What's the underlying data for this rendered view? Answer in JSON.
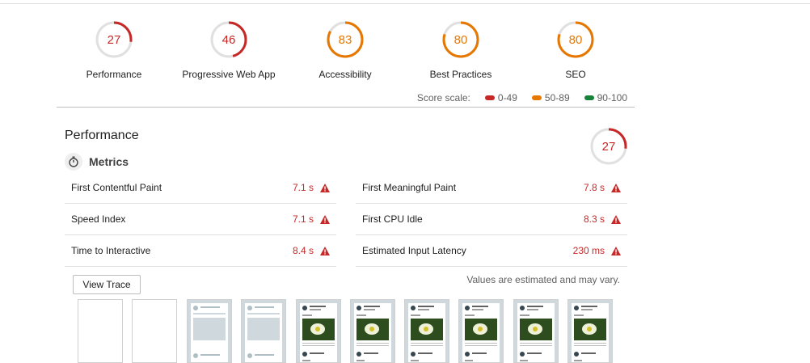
{
  "gauges": [
    {
      "score": "27",
      "label": "Performance",
      "value": 27,
      "color": "#c62828"
    },
    {
      "score": "46",
      "label": "Progressive Web App",
      "value": 46,
      "color": "#c62828"
    },
    {
      "score": "83",
      "label": "Accessibility",
      "value": 83,
      "color": "#e67700"
    },
    {
      "score": "80",
      "label": "Best Practices",
      "value": 80,
      "color": "#e67700"
    },
    {
      "score": "80",
      "label": "SEO",
      "value": 80,
      "color": "#e67700"
    }
  ],
  "legend": {
    "title": "Score scale:",
    "items": [
      {
        "label": "0-49",
        "color": "#c62828"
      },
      {
        "label": "50-89",
        "color": "#e67700"
      },
      {
        "label": "90-100",
        "color": "#178239"
      }
    ]
  },
  "performance": {
    "title": "Performance",
    "score": "27",
    "score_value": 27,
    "metrics_title": "Metrics",
    "left_metrics": [
      {
        "name": "First Contentful Paint",
        "value": "7.1 s"
      },
      {
        "name": "Speed Index",
        "value": "7.1 s"
      },
      {
        "name": "Time to Interactive",
        "value": "8.4 s"
      }
    ],
    "right_metrics": [
      {
        "name": "First Meaningful Paint",
        "value": "7.8 s"
      },
      {
        "name": "First CPU Idle",
        "value": "8.3 s"
      },
      {
        "name": "Estimated Input Latency",
        "value": "230 ms"
      }
    ],
    "view_trace_label": "View Trace",
    "note": "Values are estimated and may vary."
  },
  "filmstrip": {
    "frames": [
      "blank",
      "blank",
      "skeleton",
      "skeleton",
      "loaded",
      "loaded",
      "loaded",
      "loaded",
      "loaded",
      "loaded"
    ]
  },
  "colors": {
    "fail": "#c62828",
    "average": "#e67700",
    "pass": "#178239"
  }
}
